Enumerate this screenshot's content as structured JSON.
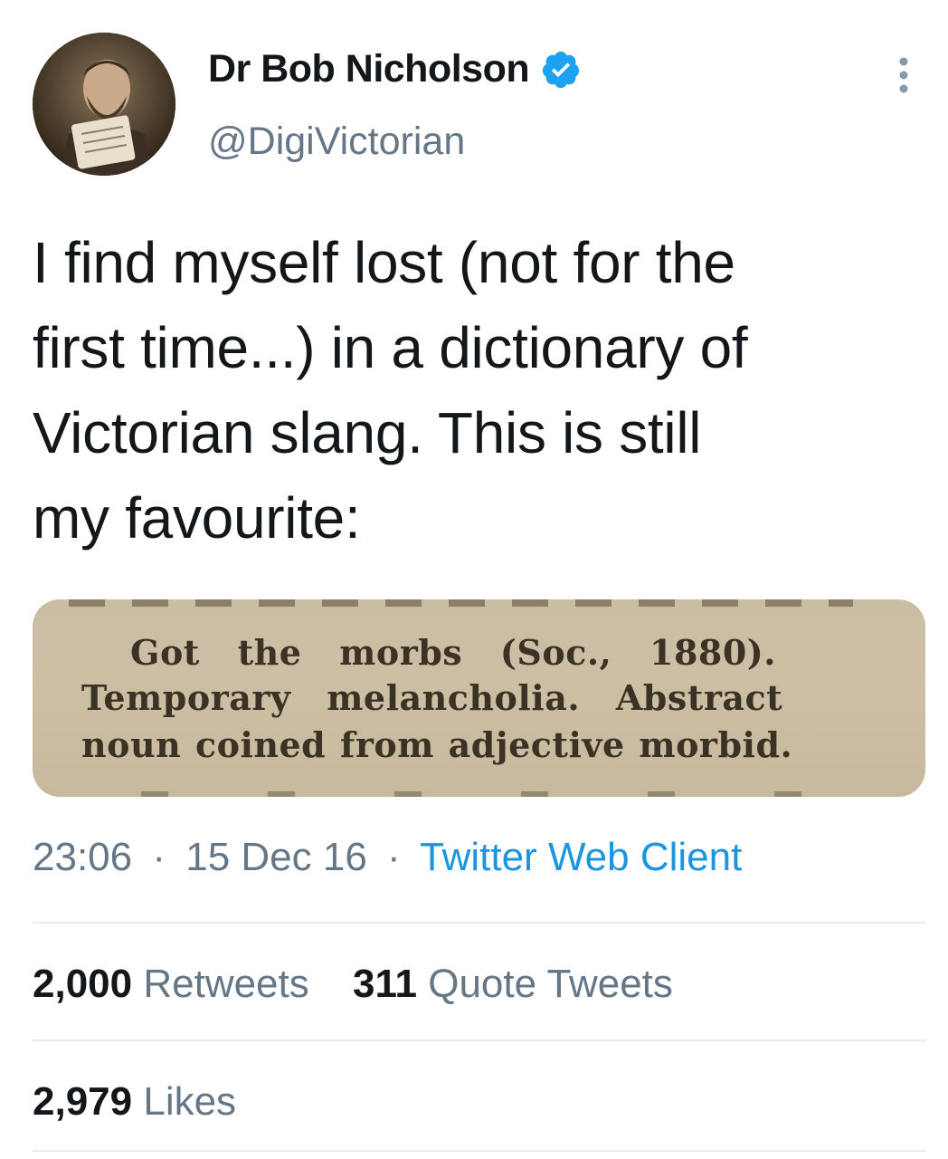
{
  "author": {
    "display_name": "Dr Bob Nicholson",
    "handle": "@DigiVictorian",
    "verified": true
  },
  "tweet": {
    "lines": [
      "I find myself lost (not for the",
      "first time...) in a dictionary of",
      "Victorian slang. This is still",
      "my favourite:"
    ]
  },
  "media": {
    "lines": [
      "Got the morbs (Soc., 1880).",
      "Temporary melancholia. Abstract",
      "noun coined from adjective morbid."
    ]
  },
  "meta": {
    "time": "23:06",
    "date": "15 Dec 16",
    "separator": "·",
    "source": "Twitter Web Client"
  },
  "stats": {
    "retweets_count": "2,000",
    "retweets_label": "Retweets",
    "quotes_count": "311",
    "quotes_label": "Quote Tweets",
    "likes_count": "2,979",
    "likes_label": "Likes"
  },
  "colors": {
    "text": "#14171a",
    "secondary": "#657786",
    "link": "#1b95e0",
    "verified": "#1da1f2",
    "divider": "#e6ecf0"
  },
  "icons": {
    "verified": "verified-badge-icon",
    "more": "more-options-icon"
  }
}
